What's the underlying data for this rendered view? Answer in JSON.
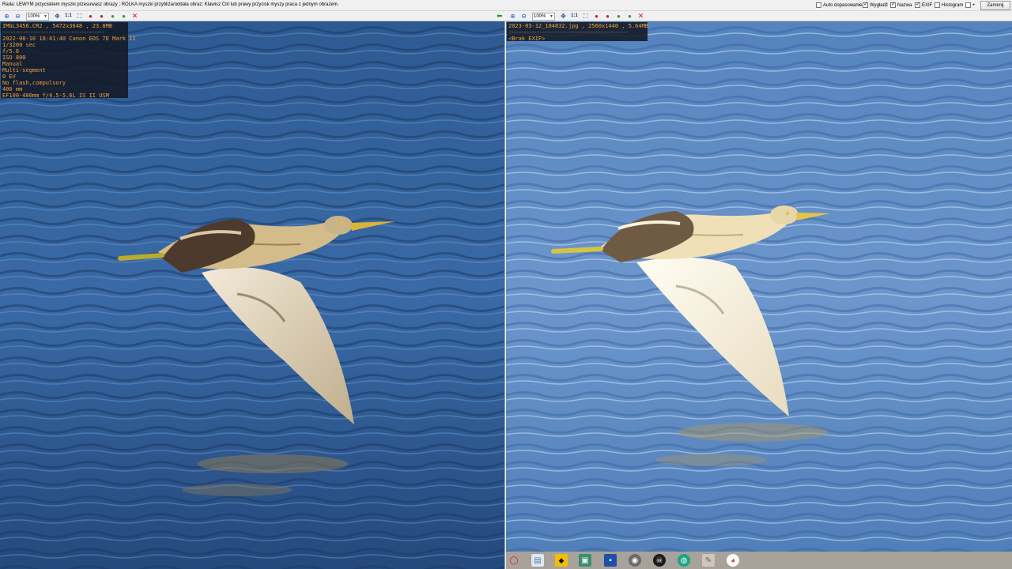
{
  "hint": "Rada: LEWYM przyciskiem myszki przesuwasz obrazy ; ROLKA myszki przybliża/oddala obraz; Klawisz Ctrl lub prawy przycisk myszy praca z jednym obrazem.",
  "options": {
    "auto_fit": "Auto dopasowanie",
    "smoothing": "Wygładź",
    "name": "Nazwa",
    "exif": "EXIF",
    "histogram": "Histogram",
    "plus": "+"
  },
  "close_label": "Zamknij",
  "left_toolbar": {
    "zoom": "100%",
    "one_to_one": "1:1"
  },
  "right_toolbar": {
    "zoom": "100%",
    "one_to_one": "1:1"
  },
  "left_exif": {
    "title": "IMGL3456.CR2 , 5472x3648 , 23.8MB",
    "separator": "----------------------------------------",
    "lines": [
      "2022-08-10 18:41:40  Canon EOS 7D Mark II",
      "1/3200 sec",
      "f/5.6",
      "ISO 800",
      "Manual",
      "Multi-segment",
      "0 EV",
      "No flash,compulsory",
      "400 mm",
      "EF100-400mm f/4.5-5.6L IS II USM"
    ]
  },
  "right_exif": {
    "title": "2023-03-12_104832.jpg , 2560x1440 , 5.64MB",
    "separator": "-----------------------------------------------",
    "no_exif": "<Brak EXIF>"
  },
  "taskbar_icons": [
    "opera-icon",
    "notepad-icon",
    "batman-icon",
    "image-viewer-icon",
    "save-icon",
    "globe-icon",
    "skull-icon",
    "earth-icon",
    "gimp-icon",
    "chrome-icon"
  ],
  "colors": {
    "exif_text": "#f2a23a",
    "exif_bg": "#121926",
    "water_left": "#2a4f86",
    "water_right": "#5d86bf"
  }
}
